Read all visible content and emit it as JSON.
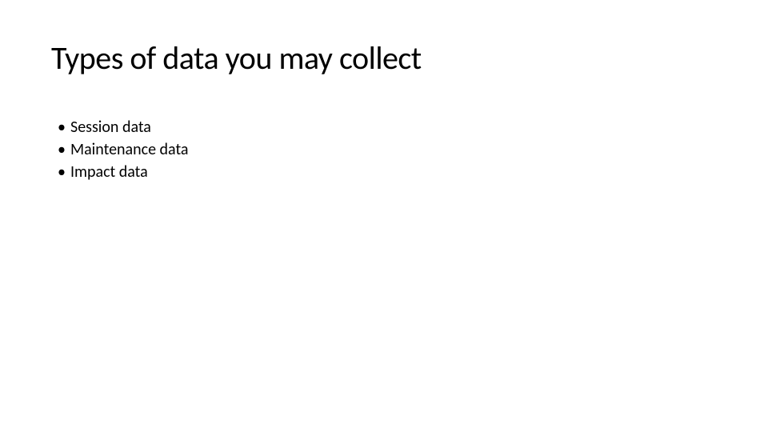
{
  "slide": {
    "title": "Types of data you may collect",
    "bullets": [
      "Session data",
      "Maintenance data",
      "Impact data"
    ]
  }
}
